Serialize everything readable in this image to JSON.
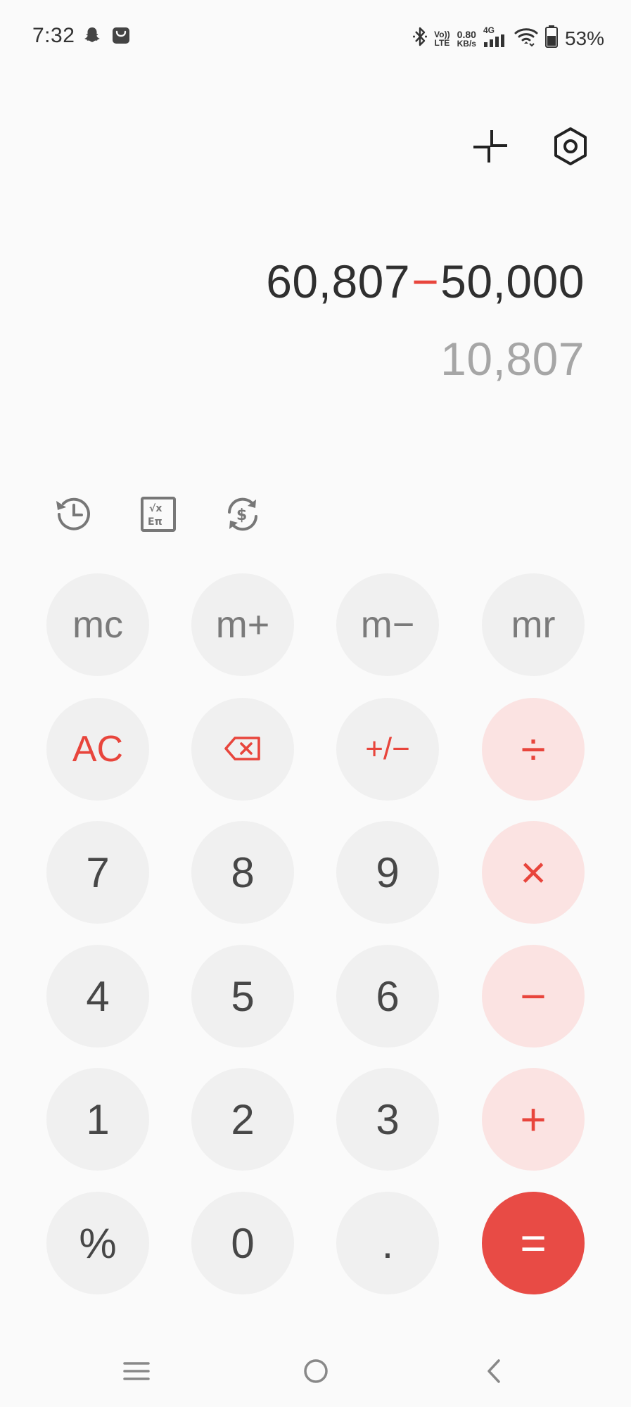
{
  "status_bar": {
    "time": "7:32",
    "left_icons": [
      "snapchat-icon",
      "shopping-bag-icon"
    ],
    "volte_top": "Vo))",
    "volte_bottom": "LTE",
    "speed_value": "0.80",
    "speed_unit": "KB/s",
    "network": "4G",
    "battery": "53%",
    "right_icons": [
      "bluetooth-icon",
      "signal-icon",
      "wifi-icon",
      "battery-icon"
    ]
  },
  "top_actions": {
    "icons": [
      "collapse-icon",
      "settings-icon"
    ]
  },
  "display": {
    "left_operand": "60,807",
    "operator": "−",
    "right_operand": "50,000",
    "result": "10,807"
  },
  "tools": {
    "icons": [
      "history-icon",
      "scientific-icon",
      "currency-convert-icon"
    ]
  },
  "keypad": {
    "rows": [
      [
        "mc",
        "m+",
        "m−",
        "mr"
      ],
      [
        "AC",
        "backspace",
        "+/−",
        "÷"
      ],
      [
        "7",
        "8",
        "9",
        "×"
      ],
      [
        "4",
        "5",
        "6",
        "−"
      ],
      [
        "1",
        "2",
        "3",
        "+"
      ],
      [
        "%",
        "0",
        ".",
        "="
      ]
    ],
    "labels": {
      "mc": "mc",
      "mplus": "m+",
      "mminus": "m−",
      "mr": "mr",
      "ac": "AC",
      "sign": "+/−",
      "divide": "÷",
      "seven": "7",
      "eight": "8",
      "nine": "9",
      "multiply": "×",
      "four": "4",
      "five": "5",
      "six": "6",
      "minus": "−",
      "one": "1",
      "two": "2",
      "three": "3",
      "plus": "+",
      "percent": "%",
      "zero": "0",
      "decimal": ".",
      "equals": "="
    }
  },
  "colors": {
    "accent": "#e8453c",
    "operator_bg": "#fbe3e2",
    "key_bg": "#f0f0f0",
    "background": "#fafafa",
    "result_text": "#a6a6a6"
  },
  "nav_bar": {
    "icons": [
      "menu-icon",
      "home-icon",
      "back-icon"
    ]
  }
}
